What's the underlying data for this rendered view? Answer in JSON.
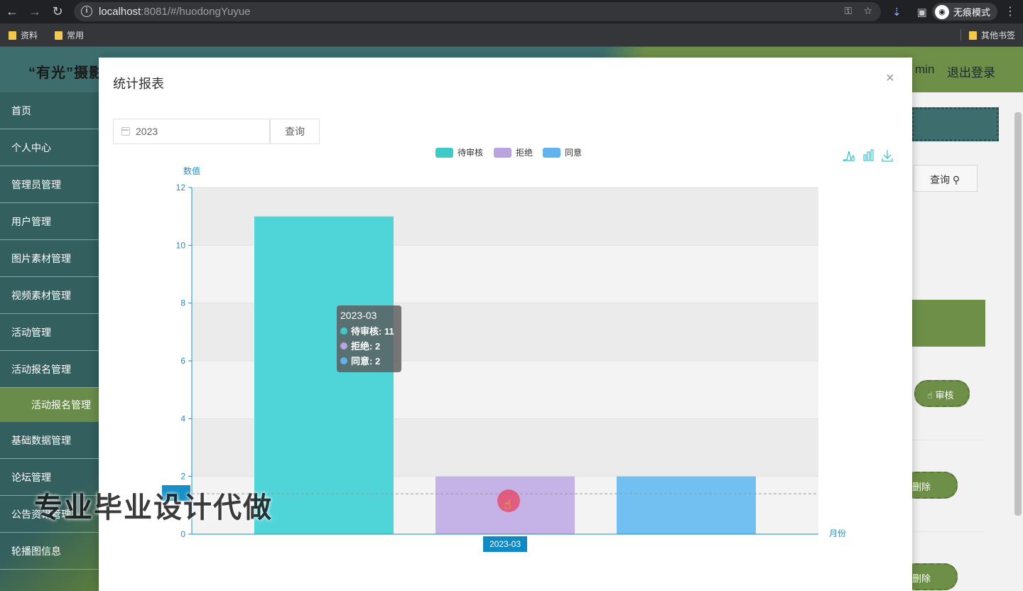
{
  "browser": {
    "url_host": "localhost",
    "url_rest": ":8081/#/huodongYuyue",
    "incognito_label": "无痕模式",
    "bookmarks": [
      "资料",
      "常用"
    ],
    "other_bookmarks": "其他书签"
  },
  "app": {
    "title": "“有光”摄影",
    "user_suffix": "min",
    "logout": "退出登录",
    "sidebar": {
      "items": [
        "首页",
        "个人中心",
        "管理员管理",
        "用户管理",
        "图片素材管理",
        "视频素材管理",
        "活动管理",
        "活动报名管理",
        "基础数据管理",
        "论坛管理",
        "公告资讯管理",
        "轮播图信息"
      ],
      "sub_item": "活动报名管理"
    },
    "right": {
      "query_btn": "查询",
      "audit_btn": "审核",
      "delete_btn": "删除"
    }
  },
  "modal": {
    "title": "统计报表",
    "close": "×",
    "date_value": "2023",
    "query_btn": "查询"
  },
  "chart_data": {
    "type": "bar",
    "categories": [
      "2023-03"
    ],
    "series": [
      {
        "name": "待审核",
        "values": [
          11
        ],
        "color": "#4fd4d8"
      },
      {
        "name": "拒绝",
        "values": [
          2
        ],
        "color": "#c5b3e8"
      },
      {
        "name": "同意",
        "values": [
          2
        ],
        "color": "#72bff2"
      }
    ],
    "legend_colors": [
      "#3ecbc8",
      "#b9a4e0",
      "#62b2ec"
    ],
    "ylabel": "数值",
    "xlabel": "月份",
    "ylim": [
      0,
      12
    ],
    "yticks": [
      0,
      2,
      4,
      6,
      8,
      10,
      12
    ],
    "legend_position": "top-center",
    "axis_color": "#1c8fc4",
    "pointer_value": 1.4,
    "x_label_highlight": "2023-03"
  },
  "tooltip": {
    "title": "2023-03",
    "rows": [
      {
        "label": "待审核: 11",
        "color": "#3ecbc8"
      },
      {
        "label": "拒绝: 2",
        "color": "#b9a4e0"
      },
      {
        "label": "同意: 2",
        "color": "#62b2ec"
      }
    ]
  },
  "watermark": "专业毕业设计代做"
}
